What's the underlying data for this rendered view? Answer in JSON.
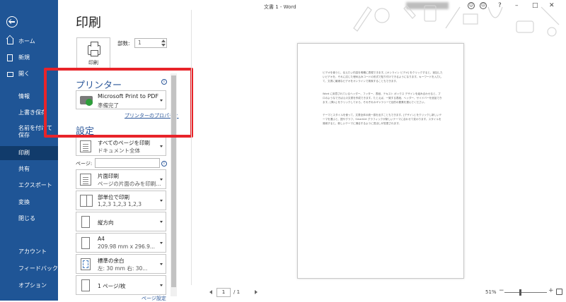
{
  "window": {
    "title": "文書 1 - Word"
  },
  "nav": {
    "items": [
      {
        "label": "ホーム",
        "icon": "home-icon"
      },
      {
        "label": "新規",
        "icon": "new-document-icon"
      },
      {
        "label": "開く",
        "icon": "open-folder-icon"
      },
      {
        "label": "情報"
      },
      {
        "label": "上書き保存"
      },
      {
        "label": "名前を付けて保存"
      },
      {
        "label": "印刷"
      },
      {
        "label": "共有"
      },
      {
        "label": "エクスポート"
      },
      {
        "label": "変換"
      },
      {
        "label": "閉じる"
      },
      {
        "label": "アカウント"
      },
      {
        "label": "フィードバック"
      },
      {
        "label": "オプション"
      }
    ]
  },
  "print": {
    "title": "印刷",
    "print_button": "印刷",
    "copies_label": "部数:",
    "copies_value": "1",
    "printer_heading": "プリンター",
    "printer_name": "Microsoft Print to PDF",
    "printer_status": "準備完了",
    "printer_properties": "プリンターのプロパティ",
    "settings_heading": "設定",
    "pages_label": "ページ:",
    "pages_value": "",
    "settings": [
      {
        "line1": "すべてのページを印刷",
        "line2": "ドキュメント全体"
      },
      {
        "line1": "片面印刷",
        "line2": "ページの片面のみを印刷..."
      },
      {
        "line1": "部単位で印刷",
        "line2": "1,2,3    1,2,3    1,2,3"
      },
      {
        "line1": "縦方向",
        "line2": ""
      },
      {
        "line1": "A4",
        "line2": "209.98 mm x 296.9..."
      },
      {
        "line1": "標準の余白",
        "line2": "左: 30 mm  右: 30..."
      },
      {
        "line1": "1 ページ/枚",
        "line2": ""
      }
    ],
    "page_setup_link": "ページ設定"
  },
  "preview": {
    "paragraphs": [
      "ビデオを使うと、伝えたい内容を明確に表現できます。[オンライン ビデオ] をクリックすると、追加したいビデオを、それに応じた埋め込みコードの形式で貼り付けできるようになります。キーワードを入力して、文書に最適なビデオをオンラインで検索することもできます。",
      "Word に用意されているヘッダー、フッター、表紙、テキスト ボックス デザインを組み合わせると、プロのようなできばえの文書を作成できます。たとえば、一致する表紙、ヘッダー、サイドバーを追加できます。[挿入] をクリックしてから、それぞれのギャラリーで目的の要素を選んでください。",
      "テーマとスタイルを使って、文書全体の統一感を出すこともできます。[デザイン] をクリックし新しいテーマを選ぶと、図やグラフ、SmartArt グラフィックが新しいテーマに合わせて変わります。スタイルを適用すると、新しいテーマに適合するように見出しが変更されます。"
    ],
    "page_current": "1",
    "page_total": "/ 1",
    "zoom": "51%"
  }
}
